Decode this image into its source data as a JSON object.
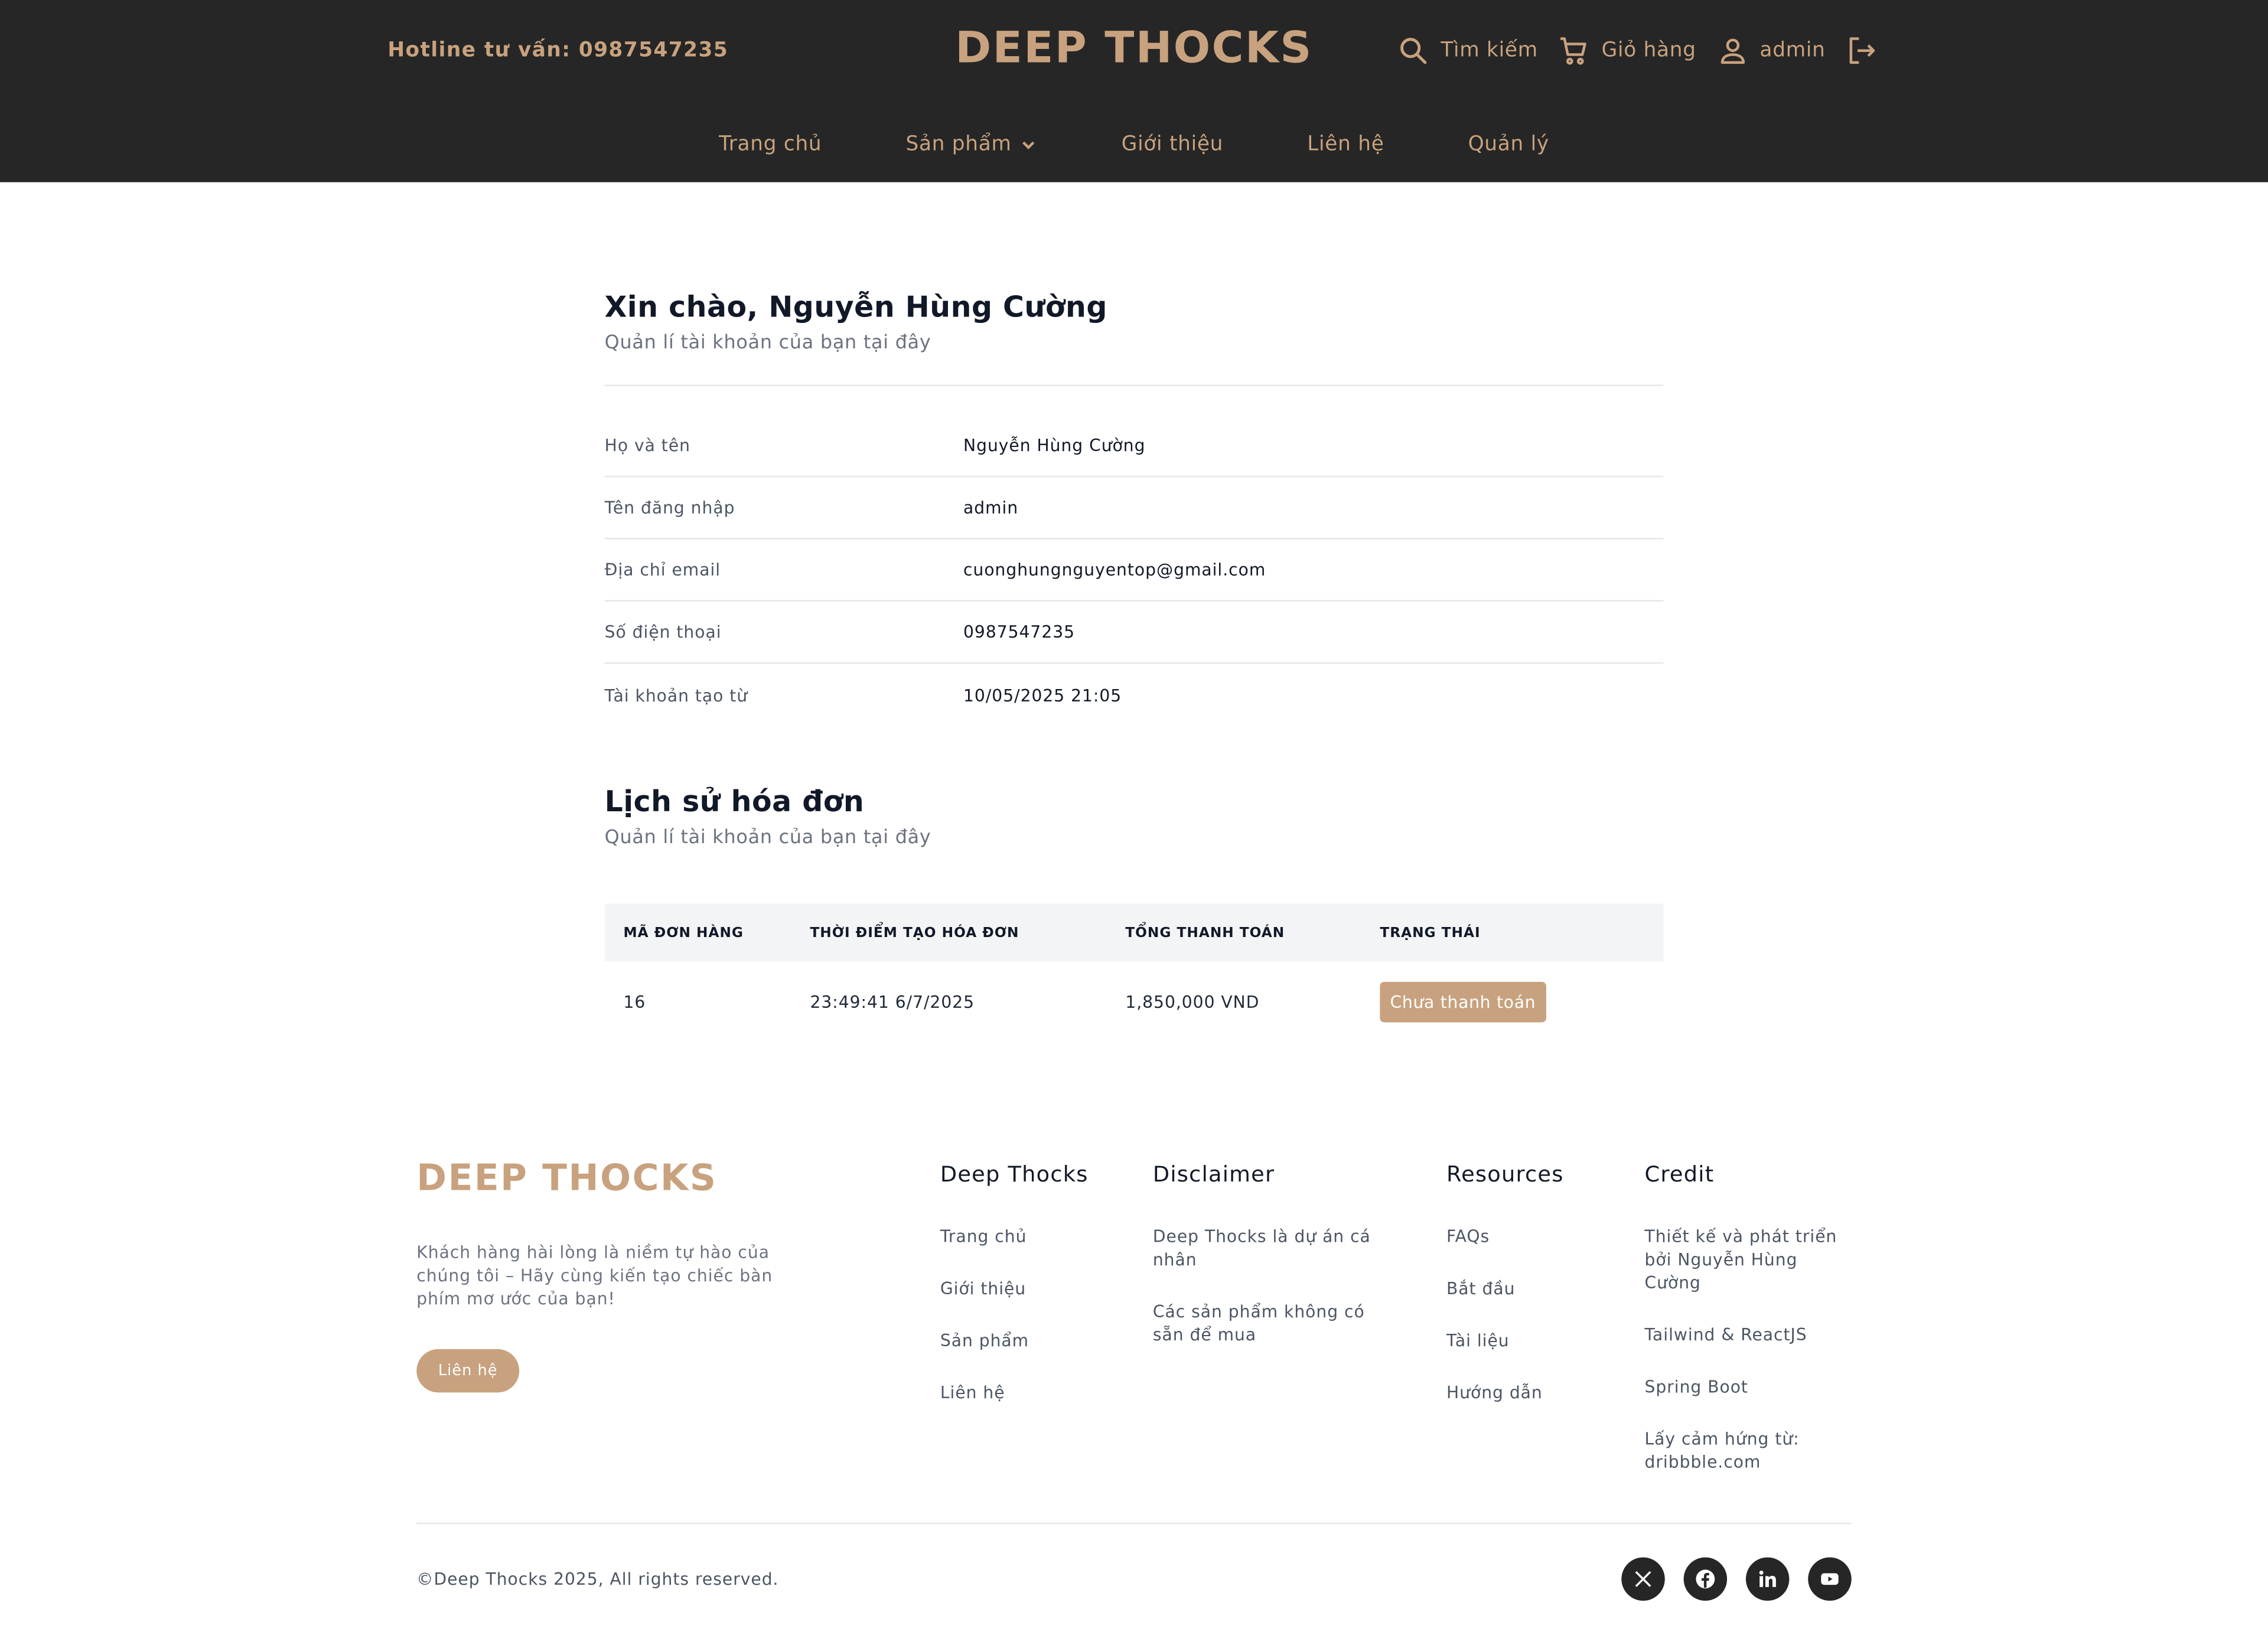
{
  "header": {
    "hotline_label": "Hotline tư vấn:",
    "hotline_number": "0987547235",
    "logo": "DEEP THOCKS",
    "search_label": "Tìm kiếm",
    "cart_label": "Giỏ hàng",
    "user_label": "admin"
  },
  "nav": {
    "items": [
      "Trang chủ",
      "Sản phẩm",
      "Giới thiệu",
      "Liên hệ",
      "Quản lý"
    ]
  },
  "account": {
    "greeting": "Xin chào, Nguyễn Hùng Cường",
    "subtitle": "Quản lí tài khoản của bạn tại đây",
    "fields": [
      {
        "label": "Họ và tên",
        "value": "Nguyễn Hùng Cường"
      },
      {
        "label": "Tên đăng nhập",
        "value": "admin"
      },
      {
        "label": "Địa chỉ email",
        "value": "cuonghungnguyentop@gmail.com"
      },
      {
        "label": "Số điện thoại",
        "value": "0987547235"
      },
      {
        "label": "Tài khoản tạo từ",
        "value": "10/05/2025 21:05"
      }
    ]
  },
  "orders": {
    "title": "Lịch sử hóa đơn",
    "subtitle": "Quản lí tài khoản của bạn tại đây",
    "columns": [
      "MÃ ĐƠN HÀNG",
      "THỜI ĐIỂM TẠO HÓA ĐƠN",
      "TỔNG THANH TOÁN",
      "TRẠNG THÁI"
    ],
    "rows": [
      {
        "id": "16",
        "time": "23:49:41 6/7/2025",
        "total": "1,850,000 VND",
        "status": "Chưa thanh toán"
      }
    ]
  },
  "footer": {
    "logo": "DEEP THOCKS",
    "description": "Khách hàng hài lòng là niềm tự hào của chúng tôi – Hãy cùng kiến tạo chiếc bàn phím mơ ước của bạn!",
    "contact_button": "Liên hệ",
    "columns": [
      {
        "title": "Deep Thocks",
        "items": [
          "Trang chủ",
          "Giới thiệu",
          "Sản phẩm",
          "Liên hệ"
        ]
      },
      {
        "title": "Disclaimer",
        "items": [
          "Deep Thocks là dự án cá nhân",
          "Các sản phẩm không có sẵn để mua"
        ]
      },
      {
        "title": "Resources",
        "items": [
          "FAQs",
          "Bắt đầu",
          "Tài liệu",
          "Hướng dẫn"
        ]
      },
      {
        "title": "Credit",
        "items": [
          "Thiết kế và phát triển bởi Nguyễn Hùng Cường",
          "Tailwind & ReactJS",
          "Spring Boot",
          "Lấy cảm hứng từ: dribbble.com"
        ]
      }
    ],
    "copyright": "©Deep Thocks 2025, All rights reserved.",
    "socials": [
      "x-icon",
      "facebook-icon",
      "linkedin-icon",
      "youtube-icon"
    ]
  },
  "colors": {
    "header_bg": "#262626",
    "accent": "#c8a27e"
  }
}
